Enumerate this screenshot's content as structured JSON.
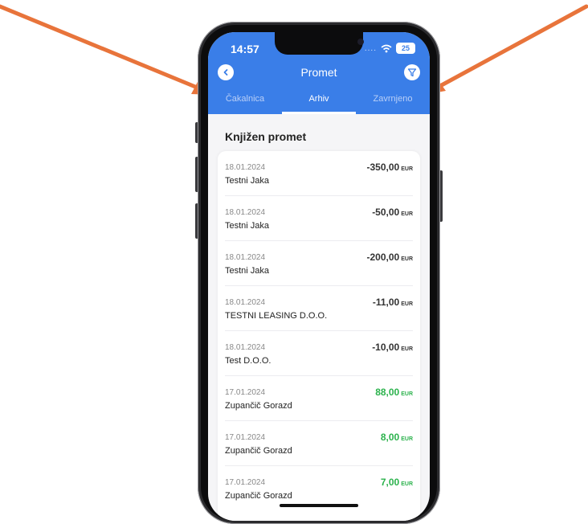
{
  "status_bar": {
    "time": "14:57",
    "signal_dots": "....",
    "battery": "25"
  },
  "header": {
    "title": "Promet",
    "back_icon": "chevron-left-icon",
    "filter_icon": "filter-icon",
    "tabs": [
      {
        "label": "Čakalnica",
        "active": false
      },
      {
        "label": "Arhiv",
        "active": true
      },
      {
        "label": "Zavrnjeno",
        "active": false
      }
    ]
  },
  "section": {
    "title": "Knjižen promet"
  },
  "transactions": [
    {
      "date": "18.01.2024",
      "name": "Testni Jaka",
      "amount": "-350,00",
      "currency": "EUR",
      "positive": false
    },
    {
      "date": "18.01.2024",
      "name": "Testni Jaka",
      "amount": "-50,00",
      "currency": "EUR",
      "positive": false
    },
    {
      "date": "18.01.2024",
      "name": "Testni Jaka",
      "amount": "-200,00",
      "currency": "EUR",
      "positive": false
    },
    {
      "date": "18.01.2024",
      "name": "TESTNI LEASING D.O.O.",
      "amount": "-11,00",
      "currency": "EUR",
      "positive": false
    },
    {
      "date": "18.01.2024",
      "name": "Test D.O.O.",
      "amount": "-10,00",
      "currency": "EUR",
      "positive": false
    },
    {
      "date": "17.01.2024",
      "name": "Zupančič Gorazd",
      "amount": "88,00",
      "currency": "EUR",
      "positive": true
    },
    {
      "date": "17.01.2024",
      "name": "Zupančič Gorazd",
      "amount": "8,00",
      "currency": "EUR",
      "positive": true
    },
    {
      "date": "17.01.2024",
      "name": "Zupančič Gorazd",
      "amount": "7,00",
      "currency": "EUR",
      "positive": true
    }
  ],
  "colors": {
    "accent": "#3a7ee8",
    "positive": "#2bb24c",
    "arrow": "#e8743b"
  }
}
